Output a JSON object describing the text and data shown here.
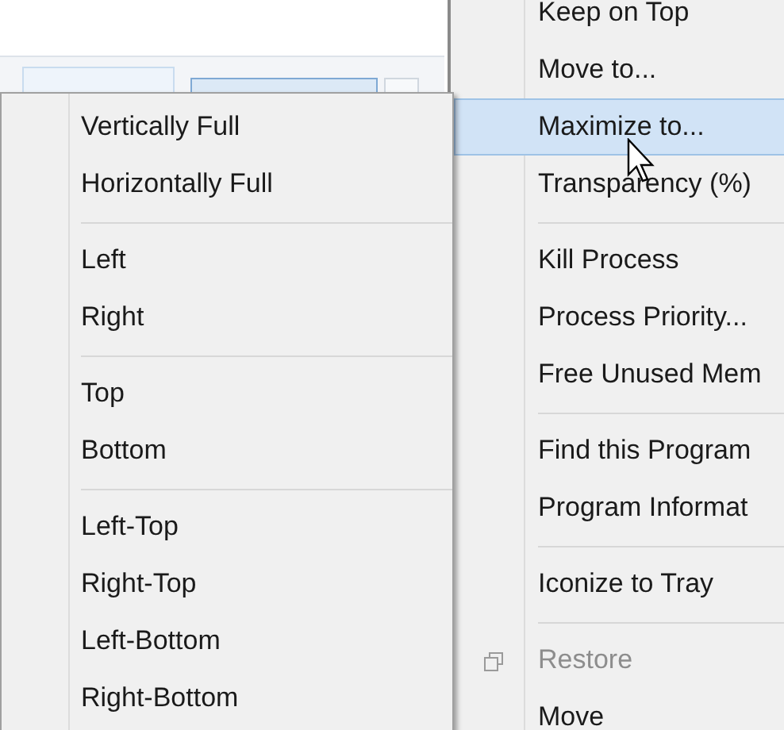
{
  "context_menu": {
    "items": [
      {
        "kind": "item",
        "label": "Keep on Top",
        "selected": false,
        "disabled": false
      },
      {
        "kind": "item",
        "label": "Move to...",
        "selected": false,
        "disabled": false
      },
      {
        "kind": "item",
        "label": "Maximize to...",
        "selected": true,
        "disabled": false
      },
      {
        "kind": "item",
        "label": "Transparency (%)",
        "selected": false,
        "disabled": false
      },
      {
        "kind": "separator"
      },
      {
        "kind": "item",
        "label": "Kill Process",
        "selected": false,
        "disabled": false
      },
      {
        "kind": "item",
        "label": "Process Priority...",
        "selected": false,
        "disabled": false
      },
      {
        "kind": "item",
        "label": "Free Unused Mem",
        "selected": false,
        "disabled": false
      },
      {
        "kind": "separator"
      },
      {
        "kind": "item",
        "label": "Find this Program",
        "selected": false,
        "disabled": false
      },
      {
        "kind": "item",
        "label": "Program Informat",
        "selected": false,
        "disabled": false
      },
      {
        "kind": "separator"
      },
      {
        "kind": "item",
        "label": "Iconize to Tray",
        "selected": false,
        "disabled": false
      },
      {
        "kind": "separator"
      },
      {
        "kind": "icon_item",
        "label": "Restore",
        "selected": false,
        "disabled": true
      },
      {
        "kind": "item",
        "label": "Move",
        "selected": false,
        "disabled": false
      }
    ]
  },
  "submenu": {
    "items": [
      {
        "kind": "item",
        "label": "Vertically Full",
        "selected": false,
        "disabled": false
      },
      {
        "kind": "item",
        "label": "Horizontally Full",
        "selected": false,
        "disabled": false
      },
      {
        "kind": "separator"
      },
      {
        "kind": "item",
        "label": "Left",
        "selected": false,
        "disabled": false
      },
      {
        "kind": "item",
        "label": "Right",
        "selected": false,
        "disabled": false
      },
      {
        "kind": "separator"
      },
      {
        "kind": "item",
        "label": "Top",
        "selected": false,
        "disabled": false
      },
      {
        "kind": "item",
        "label": "Bottom",
        "selected": false,
        "disabled": false
      },
      {
        "kind": "separator"
      },
      {
        "kind": "item",
        "label": "Left-Top",
        "selected": false,
        "disabled": false
      },
      {
        "kind": "item",
        "label": "Right-Top",
        "selected": false,
        "disabled": false
      },
      {
        "kind": "item",
        "label": "Left-Bottom",
        "selected": false,
        "disabled": false
      },
      {
        "kind": "item",
        "label": "Right-Bottom",
        "selected": false,
        "disabled": false
      }
    ]
  }
}
